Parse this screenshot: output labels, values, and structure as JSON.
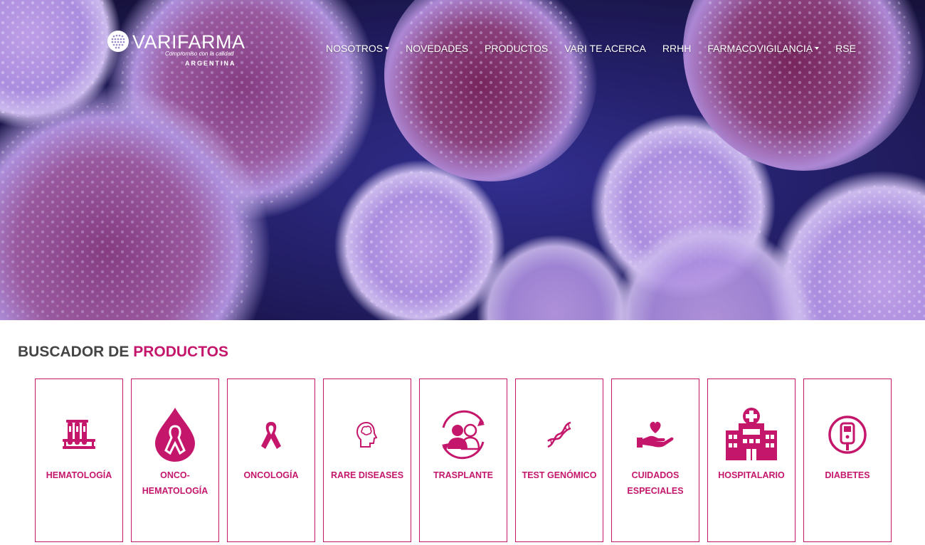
{
  "brand": {
    "name": "VARIFARMA",
    "tagline": "Compromiso con la calidad",
    "country": "ARGENTINA"
  },
  "nav": [
    {
      "label": "NOSOTROS",
      "dropdown": true
    },
    {
      "label": "NOVEDADES",
      "dropdown": false
    },
    {
      "label": "PRODUCTOS",
      "dropdown": false
    },
    {
      "label": "VARI TE ACERCA",
      "dropdown": false
    },
    {
      "label": "RRHH",
      "dropdown": false
    },
    {
      "label": "FARMACOVIGILANCIA",
      "dropdown": true
    },
    {
      "label": "RSE",
      "dropdown": false
    }
  ],
  "products_section": {
    "title_lead": "BUSCADOR DE",
    "title_accent": "PRODUCTOS"
  },
  "categories": [
    {
      "label": "HEMATOLOGÍA",
      "icon": "test-tubes-icon"
    },
    {
      "label": "ONCO-HEMATOLOGÍA",
      "icon": "blood-drop-ribbon-icon"
    },
    {
      "label": "ONCOLOGÍA",
      "icon": "ribbon-icon"
    },
    {
      "label": "RARE DISEASES",
      "icon": "head-brain-icon"
    },
    {
      "label": "TRASPLANTE",
      "icon": "people-exchange-icon"
    },
    {
      "label": "TEST GENÓMICO",
      "icon": "dna-icon"
    },
    {
      "label": "CUIDADOS ESPECIALES",
      "icon": "hand-heart-icon"
    },
    {
      "label": "HOSPITALARIO",
      "icon": "hospital-icon"
    },
    {
      "label": "DIABETES",
      "icon": "glucometer-icon"
    }
  ],
  "colors": {
    "accent": "#c4176c",
    "hero_bg": "#1a1240",
    "cell_purple": "#a88ad8"
  }
}
